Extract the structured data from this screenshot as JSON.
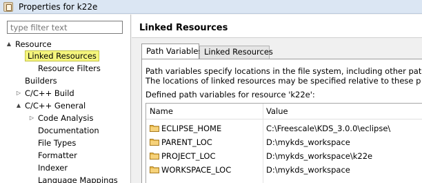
{
  "window": {
    "title": "Properties for k22e"
  },
  "filter": {
    "placeholder": "type filter text"
  },
  "tree": {
    "items": [
      {
        "label": "Resource",
        "twisty": "▲"
      },
      {
        "label": "Linked Resources"
      },
      {
        "label": "Resource Filters"
      },
      {
        "label": "Builders"
      },
      {
        "label": "C/C++ Build",
        "twisty": "▷"
      },
      {
        "label": "C/C++ General",
        "twisty": "▲"
      },
      {
        "label": "Code Analysis",
        "twisty": "▷"
      },
      {
        "label": "Documentation"
      },
      {
        "label": "File Types"
      },
      {
        "label": "Formatter"
      },
      {
        "label": "Indexer"
      },
      {
        "label": "Language Mappings"
      }
    ]
  },
  "main": {
    "title": "Linked Resources",
    "tabs": [
      {
        "label": "Path Variables"
      },
      {
        "label": "Linked Resources"
      }
    ],
    "description_1": "Path variables specify locations in the file system, including other path variab",
    "description_2": "The locations of linked resources may be specified relative to these path varia",
    "defined_label": "Defined path variables for resource 'k22e':",
    "table": {
      "columns": [
        "Name",
        "Value"
      ],
      "rows": [
        {
          "name": "ECLIPSE_HOME",
          "value": "C:\\Freescale\\KDS_3.0.0\\eclipse\\"
        },
        {
          "name": "PARENT_LOC",
          "value": "D:\\mykds_workspace"
        },
        {
          "name": "PROJECT_LOC",
          "value": "D:\\mykds_workspace\\k22e"
        },
        {
          "name": "WORKSPACE_LOC",
          "value": "D:\\mykds_workspace"
        }
      ]
    }
  },
  "colors": {
    "selection_highlight": "#f5f57d",
    "folder": "#e8b94a",
    "titlebar": "#dbe6f3"
  }
}
